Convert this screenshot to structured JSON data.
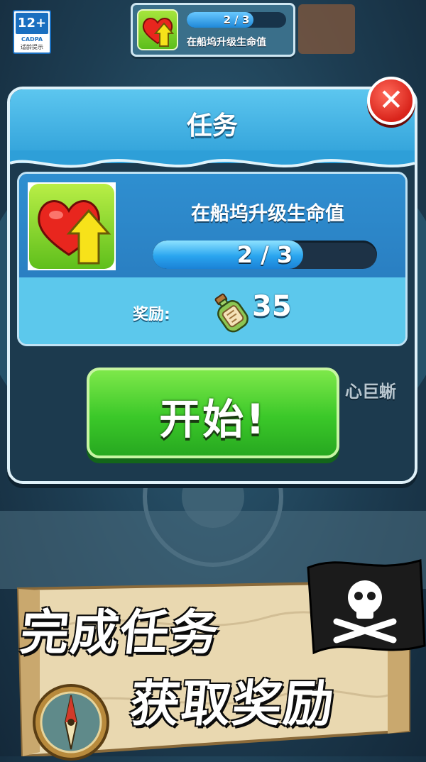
{
  "age_rating": {
    "age": "12+",
    "org": "CADPA",
    "tip": "适龄提示"
  },
  "top_hud": {
    "progress_text": "2 / 3",
    "progress": 0.67,
    "task_label": "在船坞升级生命值"
  },
  "dialog": {
    "title": "任务",
    "task": {
      "name": "在船坞升级生命值",
      "progress_text": "2 / 3",
      "progress": 0.67,
      "reward_label": "奖励:",
      "reward_value": "35"
    },
    "start_label": "开始!"
  },
  "background_text": {
    "right_peek": "心巨蜥"
  },
  "banner": {
    "line1": "完成任务",
    "line2": "获取奖励"
  },
  "colors": {
    "start_green": "#3bc829",
    "close_red": "#d9241b",
    "header_blue": "#2e9fd8",
    "progress_blue": "#2aa5ef"
  },
  "icons": {
    "task": "heart-upgrade-icon",
    "reward": "message-bottle-icon",
    "close": "close-icon",
    "flag": "pirate-flag-icon",
    "compass": "compass-icon"
  }
}
